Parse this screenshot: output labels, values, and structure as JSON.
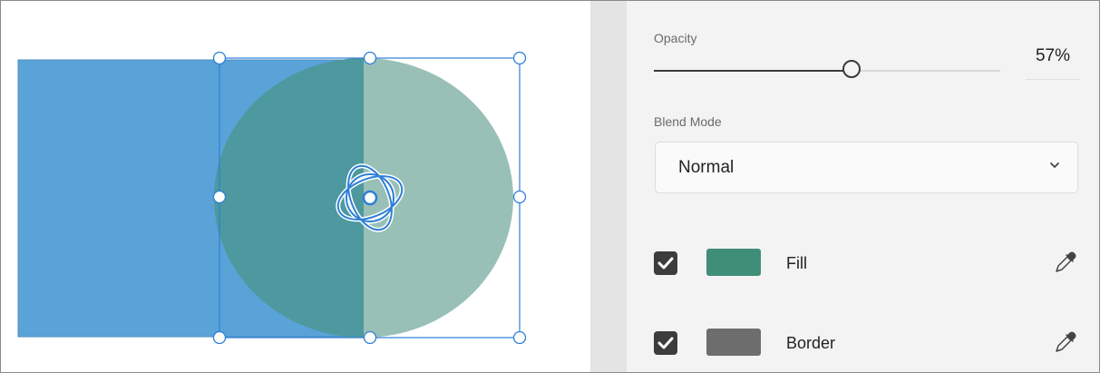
{
  "properties": {
    "opacity": {
      "label": "Opacity",
      "value_text": "57%",
      "value": 0.57
    },
    "blend_mode": {
      "label": "Blend Mode",
      "selected": "Normal"
    },
    "fill": {
      "label": "Fill",
      "checked": true,
      "color": "#3f8e78"
    },
    "border": {
      "label": "Border",
      "checked": true,
      "color": "#6d6d6d"
    }
  },
  "colors": {
    "accent": "#2e7fd6",
    "rectangle": "#5aa3d8",
    "overlap": "#4e98a0",
    "circle": "#98c0b6"
  },
  "icons": {
    "rotation_handle": "rotate-icon",
    "eyedropper": "eyedropper-icon",
    "chevron": "chevron-down-icon"
  }
}
